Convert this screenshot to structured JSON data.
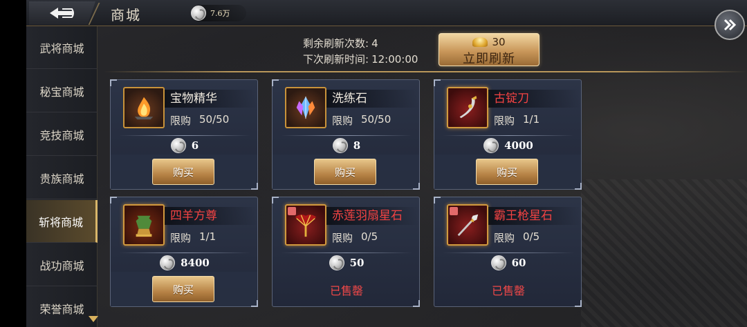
{
  "header": {
    "title": "商城",
    "currency_value": "7.6万"
  },
  "sidebar": {
    "items": [
      {
        "label": "武将商城",
        "active": false
      },
      {
        "label": "秘宝商城",
        "active": false
      },
      {
        "label": "竞技商城",
        "active": false
      },
      {
        "label": "贵族商城",
        "active": false
      },
      {
        "label": "斩将商城",
        "active": true
      },
      {
        "label": "战功商城",
        "active": false
      },
      {
        "label": "荣誉商城",
        "active": false
      }
    ]
  },
  "refresh": {
    "remaining_label": "剩余刷新次数:",
    "remaining_value": "4",
    "next_label": "下次刷新时间:",
    "next_value": "12:00:00",
    "cost": "30",
    "button_label": "立即刷新"
  },
  "shop": {
    "limit_label": "限购",
    "buy_label": "购买",
    "sold_out_label": "已售罄",
    "items": [
      {
        "name": "宝物精华",
        "name_color": "white",
        "limit": "50/50",
        "price": "6",
        "status": "buy",
        "icon": "fire-essence-icon"
      },
      {
        "name": "洗练石",
        "name_color": "white",
        "limit": "50/50",
        "price": "8",
        "status": "buy",
        "icon": "crystal-icon"
      },
      {
        "name": "古锭刀",
        "name_color": "red",
        "limit": "1/1",
        "price": "4000",
        "status": "buy",
        "icon": "saber-icon"
      },
      {
        "name": "四羊方尊",
        "name_color": "red",
        "limit": "1/1",
        "price": "8400",
        "status": "buy",
        "icon": "bronze-vessel-icon"
      },
      {
        "name": "赤莲羽扇星石",
        "name_color": "red",
        "limit": "0/5",
        "price": "50",
        "status": "sold",
        "icon": "feather-fan-icon"
      },
      {
        "name": "霸王枪星石",
        "name_color": "red",
        "limit": "0/5",
        "price": "60",
        "status": "sold",
        "icon": "spear-icon"
      }
    ]
  },
  "colors": {
    "accent_gold": "#d9b66a",
    "name_red": "#f34343",
    "sold_red": "#f04848"
  }
}
